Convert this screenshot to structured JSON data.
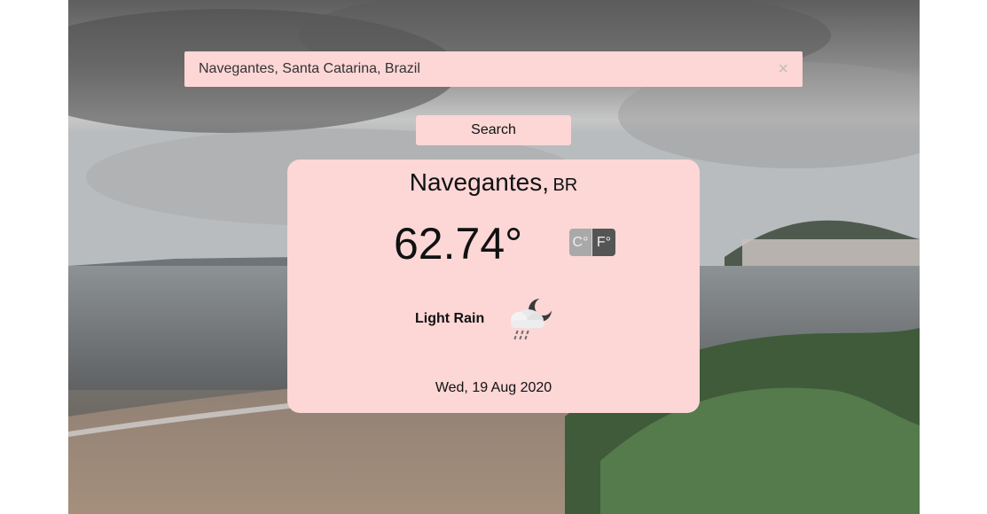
{
  "search": {
    "value": "Navegantes, Santa Catarina, Brazil",
    "clear_icon": "×",
    "button_label": "Search"
  },
  "weather": {
    "city": "Navegantes,",
    "country": "BR",
    "temperature": "62.74°",
    "unit_celsius": "C°",
    "unit_fahrenheit": "F°",
    "active_unit": "F",
    "condition": "Light Rain",
    "icon": "cloud-moon-rain-icon",
    "date": "Wed, 19 Aug 2020"
  },
  "colors": {
    "panel": "#fdd6d6",
    "unit_inactive": "#a9a9a9",
    "unit_active": "#555555"
  }
}
